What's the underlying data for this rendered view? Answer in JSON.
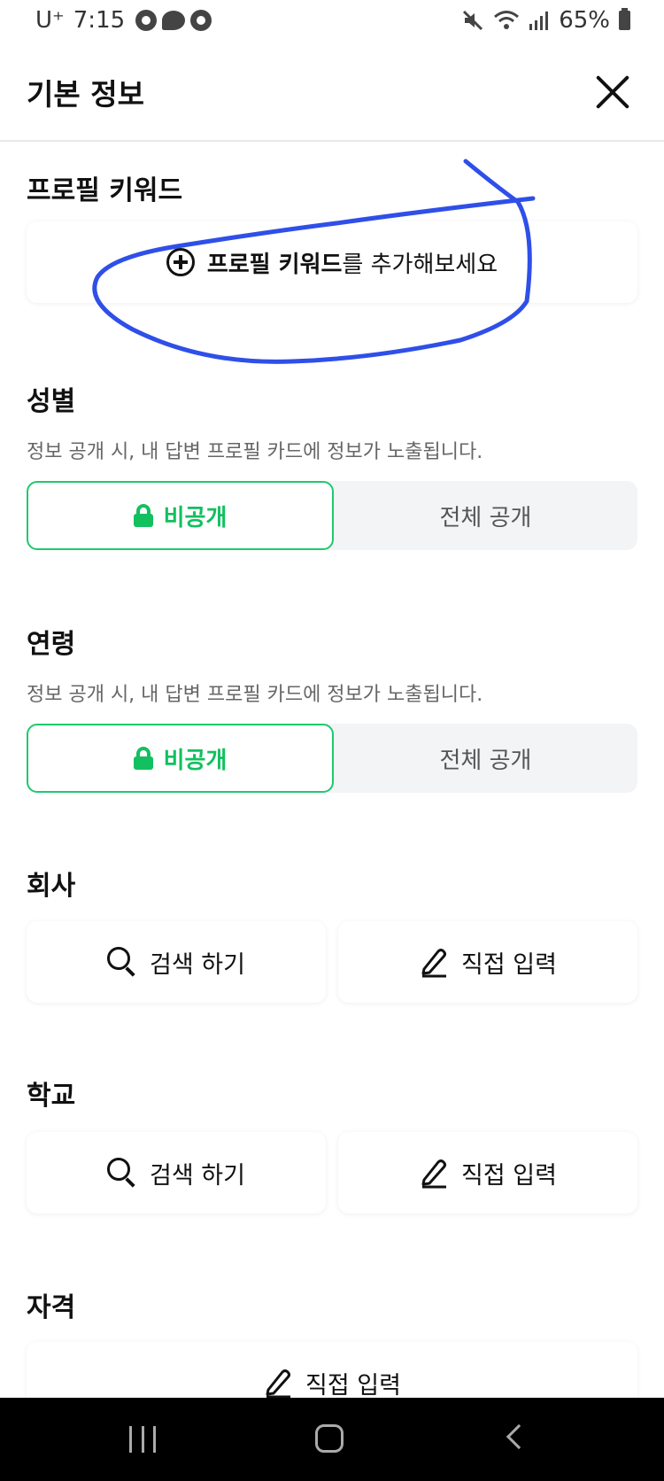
{
  "status_bar": {
    "carrier": "U⁺",
    "time": "7:15",
    "battery": "65%"
  },
  "header": {
    "title": "기본 정보"
  },
  "keyword": {
    "title": "프로필 키워드",
    "add_bold": "프로필 키워드",
    "add_rest": "를 추가해보세요"
  },
  "gender": {
    "title": "성별",
    "desc": "정보 공개 시, 내 답변 프로필 카드에 정보가 노출됩니다.",
    "private_label": "비공개",
    "public_label": "전체 공개",
    "selected": "비공개"
  },
  "age": {
    "title": "연령",
    "desc": "정보 공개 시, 내 답변 프로필 카드에 정보가 노출됩니다.",
    "private_label": "비공개",
    "public_label": "전체 공개",
    "selected": "비공개"
  },
  "company": {
    "title": "회사",
    "search_label": "검색 하기",
    "direct_label": "직접 입력"
  },
  "school": {
    "title": "학교",
    "search_label": "검색 하기",
    "direct_label": "직접 입력"
  },
  "license": {
    "title": "자격",
    "direct_label": "직접 입력"
  },
  "colors": {
    "accent": "#12c05f",
    "annotation": "#2f4fe8"
  },
  "icons": [
    "close-icon",
    "plus-circle-icon",
    "lock-icon",
    "search-icon",
    "pencil-icon"
  ]
}
